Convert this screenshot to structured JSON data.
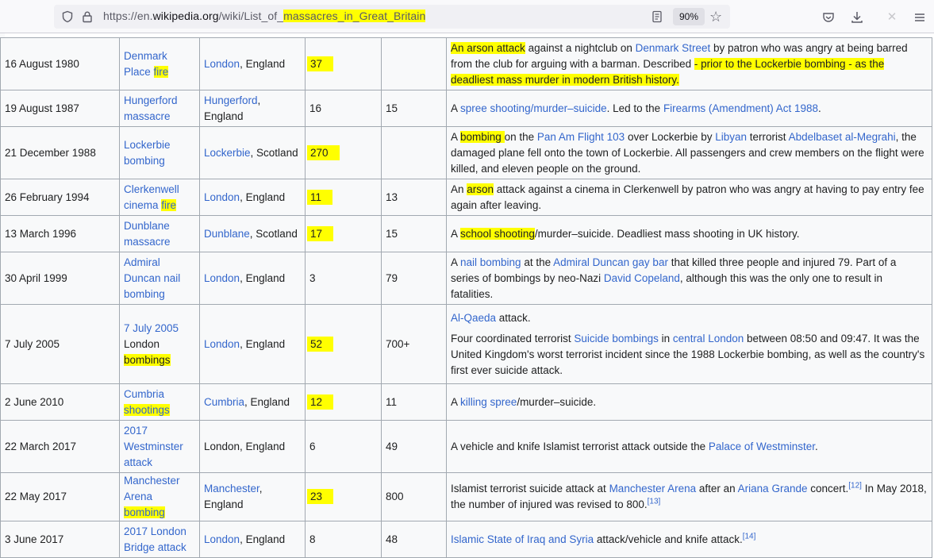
{
  "browser": {
    "url_prefix": "https://en.",
    "url_domain": "wikipedia.org",
    "url_path": "/wiki/List_of_",
    "url_highlighted": "massacres_in_Great_Britain",
    "zoom": "90%",
    "icons": [
      "shield-icon",
      "lock-icon",
      "reader-view-icon",
      "bookmark-star-icon",
      "pocket-icon",
      "download-icon",
      "extension-icon",
      "menu-icon"
    ],
    "highlight_color": "#ffff00"
  },
  "rows": [
    {
      "date": "16 August 1980",
      "name_parts": [
        {
          "t": "Denmark Place",
          "link": true
        },
        {
          "t": " "
        },
        {
          "t": "fire",
          "link": true,
          "hl": true
        }
      ],
      "location_parts": [
        {
          "t": "London",
          "link": true
        },
        {
          "t": ", England"
        }
      ],
      "deaths": "37",
      "deaths_hl": true,
      "injured": "",
      "desc": [
        [
          {
            "t": "An arson attack",
            "hl": true
          },
          {
            "t": " against a nightclub on "
          },
          {
            "t": "Denmark Street",
            "link": true
          },
          {
            "t": " by patron who was angry at being barred from the club for arguing with a barman. Described "
          },
          {
            "t": "- prior to the Lockerbie bombing - as the deadliest mass murder in modern British history.",
            "hl": true
          }
        ]
      ]
    },
    {
      "date": "19 August 1987",
      "name_parts": [
        {
          "t": "Hungerford massacre",
          "link": true,
          "visited": true
        }
      ],
      "location_parts": [
        {
          "t": "Hungerford",
          "link": true
        },
        {
          "t": ", England"
        }
      ],
      "deaths": "16",
      "injured": "15",
      "desc": [
        [
          {
            "t": "A "
          },
          {
            "t": "spree shooting/murder–suicide",
            "link": true
          },
          {
            "t": ". Led to the "
          },
          {
            "t": "Firearms (Amendment) Act 1988",
            "link": true
          },
          {
            "t": "."
          }
        ]
      ]
    },
    {
      "date": "21 December 1988",
      "name_parts": [
        {
          "t": "Lockerbie bombing",
          "link": true
        }
      ],
      "location_parts": [
        {
          "t": "Lockerbie",
          "link": true
        },
        {
          "t": ", Scotland"
        }
      ],
      "deaths": "270",
      "deaths_hl": true,
      "injured": "",
      "desc": [
        [
          {
            "t": "A "
          },
          {
            "t": "bombing ",
            "hl": true
          },
          {
            "t": "on the "
          },
          {
            "t": "Pan Am Flight 103",
            "link": true
          },
          {
            "t": " over Lockerbie by "
          },
          {
            "t": "Libyan",
            "link": true
          },
          {
            "t": " terrorist "
          },
          {
            "t": "Abdelbaset al-Megrahi",
            "link": true
          },
          {
            "t": ", the damaged plane fell onto the town of Lockerbie. All passengers and crew members on the flight were killed, and eleven people on the ground."
          }
        ]
      ]
    },
    {
      "date": "26 February 1994",
      "name_parts": [
        {
          "t": "Clerkenwell cinema ",
          "link": true
        },
        {
          "t": "fire",
          "link": true,
          "hl": true
        }
      ],
      "location_parts": [
        {
          "t": "London",
          "link": true
        },
        {
          "t": ", England"
        }
      ],
      "deaths": "11",
      "deaths_hl": true,
      "injured": "13",
      "desc": [
        [
          {
            "t": "An "
          },
          {
            "t": "arson",
            "hl": true
          },
          {
            "t": " attack against a cinema in Clerkenwell by patron who was angry at having to pay entry fee again after leaving."
          }
        ]
      ]
    },
    {
      "date": "13 March 1996",
      "name_parts": [
        {
          "t": "Dunblane massacre",
          "link": true
        }
      ],
      "location_parts": [
        {
          "t": "Dunblane",
          "link": true
        },
        {
          "t": ", Scotland"
        }
      ],
      "deaths": "17",
      "deaths_hl": true,
      "injured": "15",
      "desc": [
        [
          {
            "t": "A "
          },
          {
            "t": "school shooting",
            "hl": true
          },
          {
            "t": "/murder–suicide. Deadliest mass shooting in UK history."
          }
        ]
      ]
    },
    {
      "date": "30 April 1999",
      "name_parts": [
        {
          "t": "Admiral Duncan nail bombing",
          "link": true
        }
      ],
      "location_parts": [
        {
          "t": "London",
          "link": true
        },
        {
          "t": ", England"
        }
      ],
      "deaths": "3",
      "injured": "79",
      "desc": [
        [
          {
            "t": "A "
          },
          {
            "t": "nail bombing",
            "link": true
          },
          {
            "t": " at the "
          },
          {
            "t": "Admiral Duncan gay bar",
            "link": true
          },
          {
            "t": " that killed three people and injured 79. Part of a series of bombings by neo-Nazi "
          },
          {
            "t": "David Copeland",
            "link": true
          },
          {
            "t": ", although this was the only one to result in fatalities."
          }
        ]
      ]
    },
    {
      "date": "7 July 2005",
      "name_parts": [
        {
          "t": "7 July 2005",
          "link": true
        },
        {
          "t": " London",
          "dark": true
        },
        {
          "t": " "
        },
        {
          "t": "bombings",
          "dark": true,
          "hl": true
        }
      ],
      "location_parts": [
        {
          "t": "London",
          "link": true
        },
        {
          "t": ", England"
        }
      ],
      "deaths": "52",
      "deaths_hl": true,
      "injured": "700+",
      "desc": [
        [
          {
            "t": "Al-Qaeda",
            "link": true
          },
          {
            "t": " attack."
          }
        ],
        [
          {
            "t": "Four coordinated terrorist "
          },
          {
            "t": "Suicide bombings",
            "link": true
          },
          {
            "t": " in "
          },
          {
            "t": "central London",
            "link": true
          },
          {
            "t": " between 08:50 and 09:47. It was the United Kingdom's worst terrorist incident since the 1988 Lockerbie bombing, as well as the country's first ever suicide attack."
          }
        ]
      ]
    },
    {
      "date": "2 June 2010",
      "name_parts": [
        {
          "t": "Cumbria ",
          "link": true
        },
        {
          "t": "shootings",
          "link": true,
          "hl": true
        }
      ],
      "location_parts": [
        {
          "t": "Cumbria",
          "link": true
        },
        {
          "t": ", England"
        }
      ],
      "deaths": "12",
      "deaths_hl": true,
      "injured": "11",
      "desc": [
        [
          {
            "t": "A "
          },
          {
            "t": "killing spree",
            "link": true
          },
          {
            "t": "/murder–suicide."
          }
        ]
      ]
    },
    {
      "date": "22 March 2017",
      "name_parts": [
        {
          "t": "2017 Westminster attack",
          "link": true
        }
      ],
      "location_parts": [
        {
          "t": "London, England"
        }
      ],
      "deaths": "6",
      "injured": "49",
      "desc": [
        [
          {
            "t": "A vehicle and knife Islamist terrorist attack outside the "
          },
          {
            "t": "Palace of Westminster",
            "link": true
          },
          {
            "t": "."
          }
        ]
      ]
    },
    {
      "date": "22 May 2017",
      "name_parts": [
        {
          "t": "Manchester Arena ",
          "link": true
        },
        {
          "t": "bombing",
          "link": true,
          "hl": true
        }
      ],
      "location_parts": [
        {
          "t": "Manchester",
          "link": true
        },
        {
          "t": ", England"
        }
      ],
      "deaths": "23",
      "deaths_hl": true,
      "injured": "800",
      "desc": [
        [
          {
            "t": "Islamist terrorist suicide attack at "
          },
          {
            "t": "Manchester Arena",
            "link": true
          },
          {
            "t": " after an "
          },
          {
            "t": "Ariana Grande",
            "link": true
          },
          {
            "t": " concert."
          },
          {
            "t": "[12]",
            "link": true,
            "sup": true
          },
          {
            "t": " In May 2018, the number of injured was revised to 800."
          },
          {
            "t": "[13]",
            "link": true,
            "sup": true
          }
        ]
      ]
    },
    {
      "date": "3 June 2017",
      "name_parts": [
        {
          "t": "2017 London Bridge attack",
          "link": true
        }
      ],
      "location_parts": [
        {
          "t": "London",
          "link": true
        },
        {
          "t": ", England"
        }
      ],
      "deaths": "8",
      "injured": "48",
      "desc": [
        [
          {
            "t": "Islamic State of Iraq and Syria",
            "link": true
          },
          {
            "t": " attack/vehicle and knife attack."
          },
          {
            "t": "[14]",
            "link": true,
            "sup": true
          }
        ]
      ]
    }
  ]
}
